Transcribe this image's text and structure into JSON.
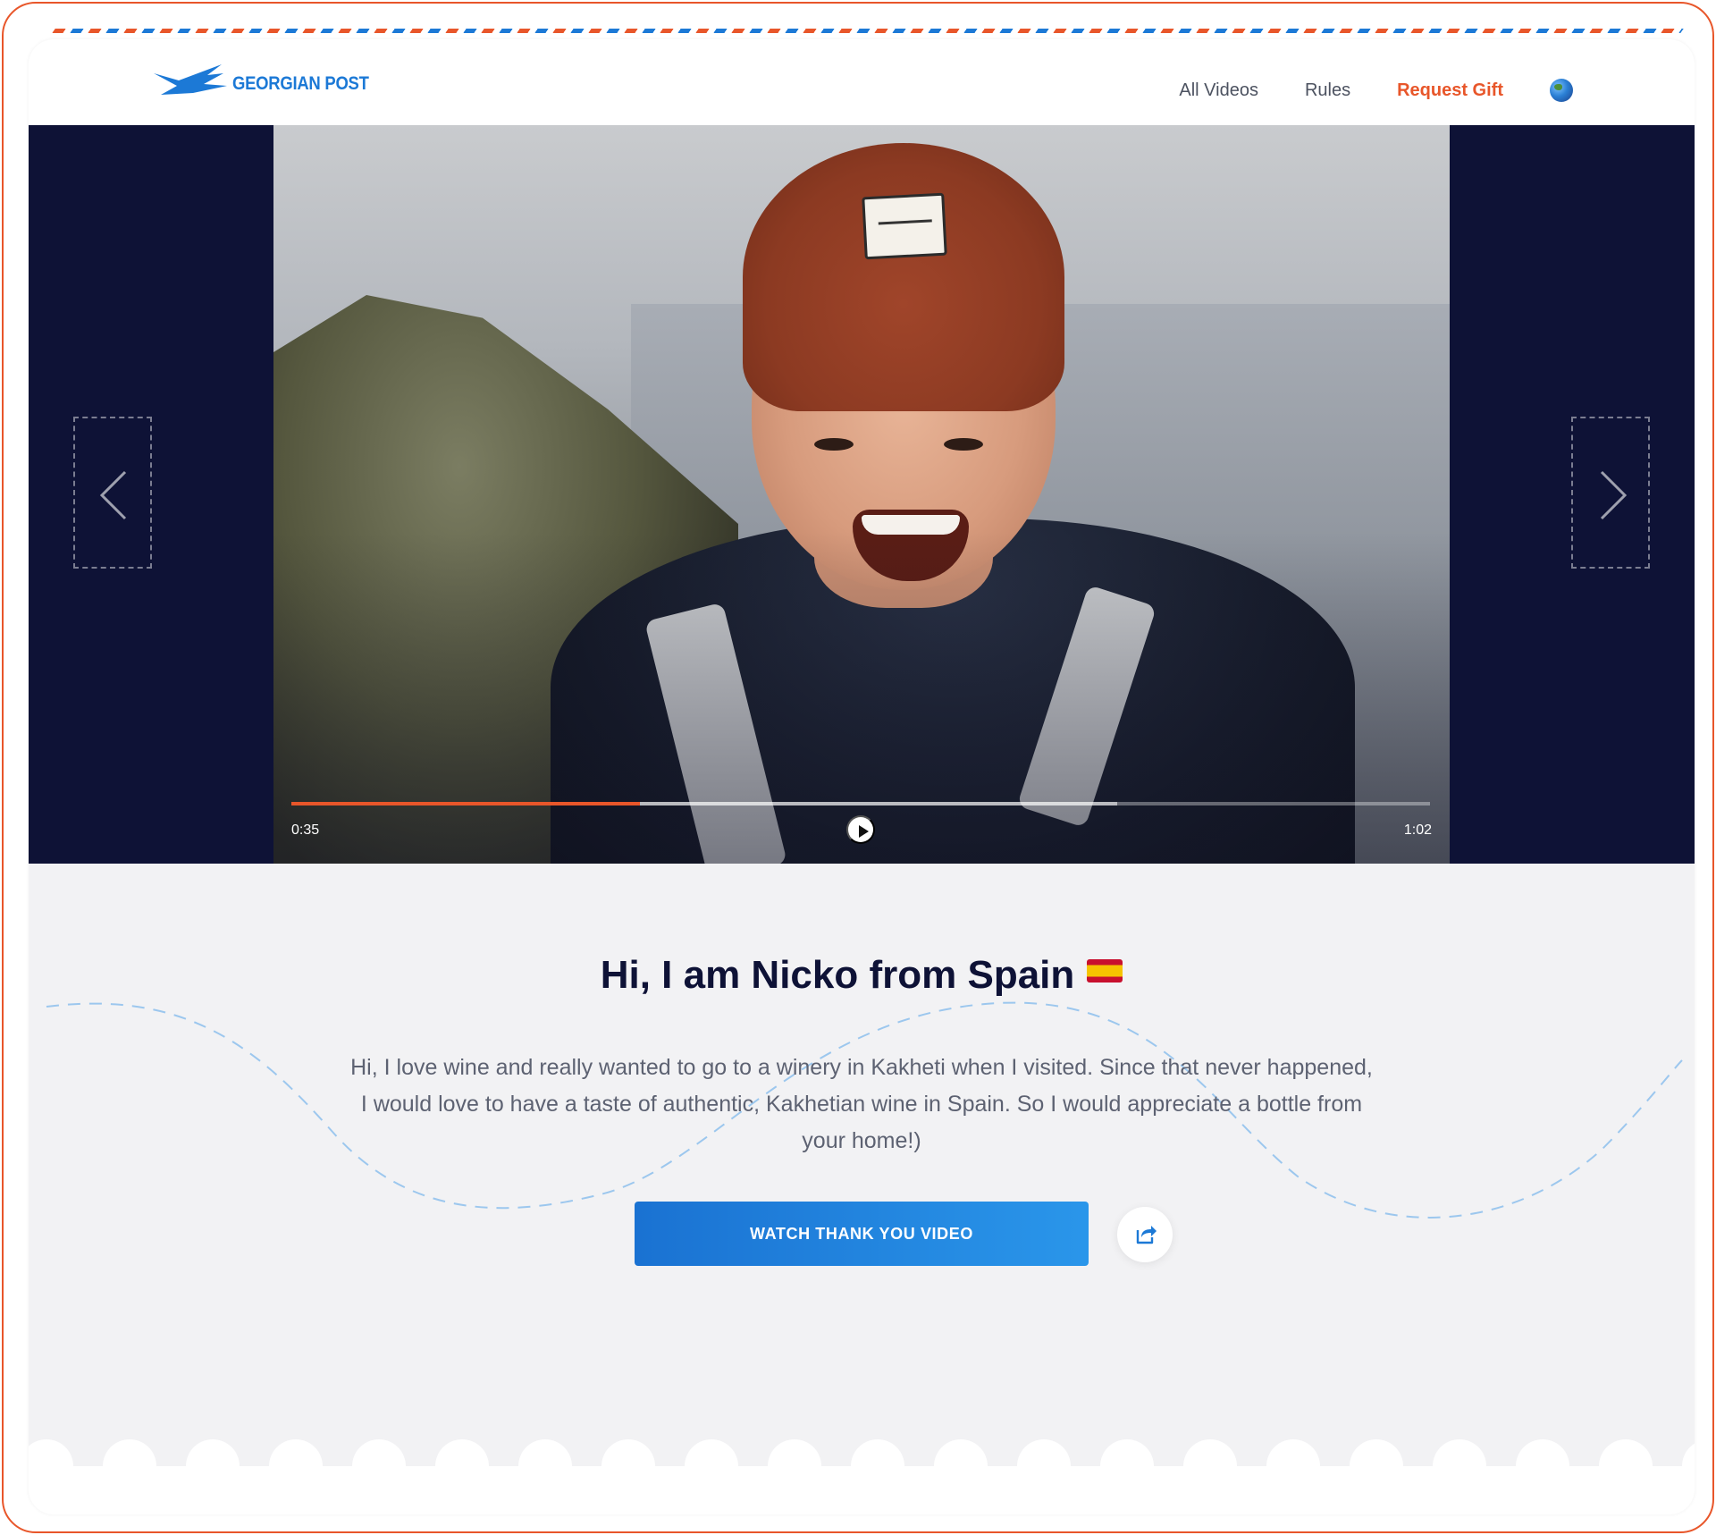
{
  "header": {
    "logo_text": "GEORGIAN POST",
    "nav": [
      {
        "label": "All Videos"
      },
      {
        "label": "Rules"
      },
      {
        "label": "Request Gift"
      }
    ],
    "language_icon": "globe-icon"
  },
  "player": {
    "current_time": "0:35",
    "duration": "1:02",
    "progress_fraction": 0.306,
    "buffered_fraction": 0.725,
    "prev_icon": "chevron-left-icon",
    "next_icon": "chevron-right-icon",
    "play_icon": "play-icon"
  },
  "profile": {
    "title": "Hi, I am Nicko from Spain",
    "flag_icon": "spain-flag-icon",
    "description": "Hi, I love wine and really wanted to go to a winery in Kakheti when I visited. Since that never happened, I would love to have a taste of authentic, Kakhetian wine in Spain. So I would appreciate a bottle from your home!)",
    "cta_label": "WATCH THANK YOU VIDEO",
    "share_icon": "share-icon"
  },
  "colors": {
    "accent": "#e8562a",
    "brand_blue": "#1c79d6",
    "navy": "#0e1236"
  }
}
